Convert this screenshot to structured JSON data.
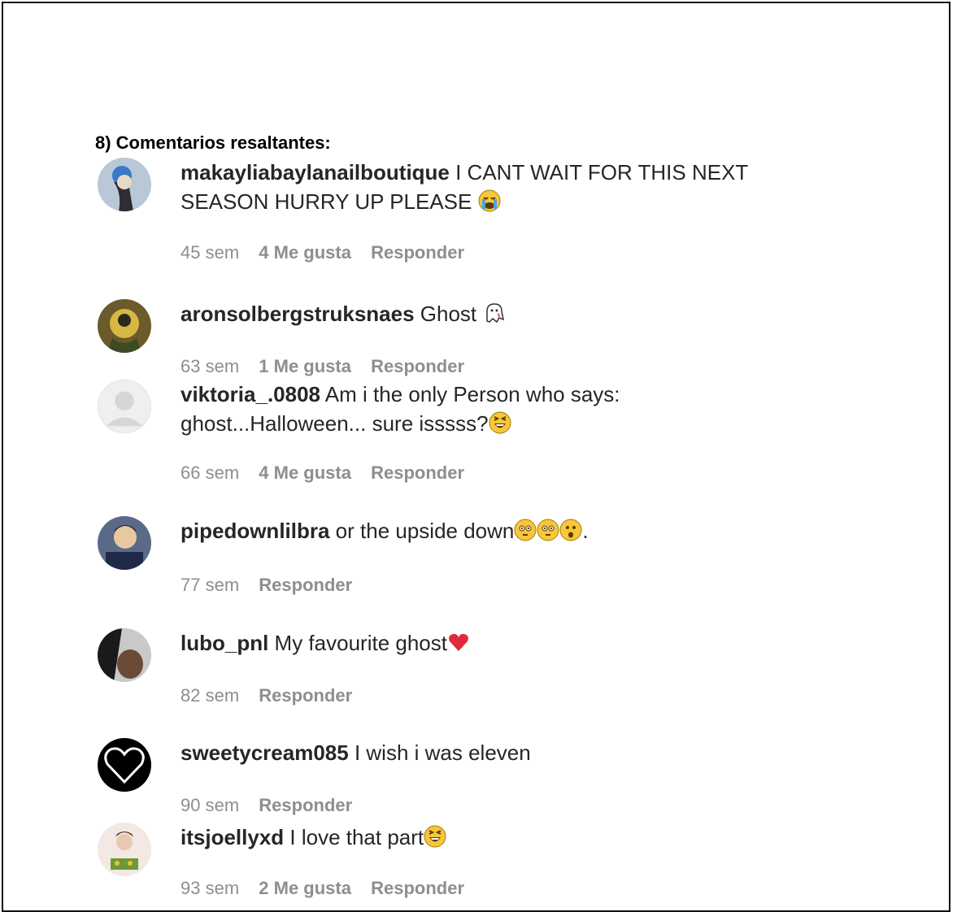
{
  "heading": "8) Comentarios resaltantes:",
  "comments": [
    {
      "username": "makayliabaylanailboutique",
      "text_line1": " I CANT WAIT FOR THIS NEXT",
      "text_line2": "SEASON HURRY UP PLEASE ",
      "emoji": "crying-face-icon",
      "time": "45 sem",
      "likes": "4 Me gusta",
      "reply": "Responder"
    },
    {
      "username": "aronsolbergstruksnaes",
      "text_line1": " Ghost ",
      "emoji": "ghost-icon",
      "time": "63 sem",
      "likes": "1 Me gusta",
      "reply": "Responder"
    },
    {
      "username": "viktoria_.0808",
      "text_line1": " Am i the only Person who says:",
      "text_line2": "ghost...Halloween... sure isssss?",
      "emoji": "laughing-face-icon",
      "time": "66 sem",
      "likes": "4 Me gusta",
      "reply": "Responder"
    },
    {
      "username": "pipedownlilbra",
      "text_line1": " or the upside down",
      "text_suffix": ".",
      "emoji": "flushed-face-icon",
      "time": "77 sem",
      "reply": "Responder"
    },
    {
      "username": "lubo_pnl",
      "text_line1": " My favourite ghost",
      "emoji": "red-heart-icon",
      "time": "82 sem",
      "reply": "Responder"
    },
    {
      "username": "sweetycream085",
      "text_line1": " I wish i was eleven",
      "time": "90 sem",
      "reply": "Responder"
    },
    {
      "username": "itsjoellyxd",
      "text_line1": " I love that part",
      "emoji": "laughing-face-icon",
      "time": "93 sem",
      "likes": "2 Me gusta",
      "reply": "Responder"
    }
  ]
}
